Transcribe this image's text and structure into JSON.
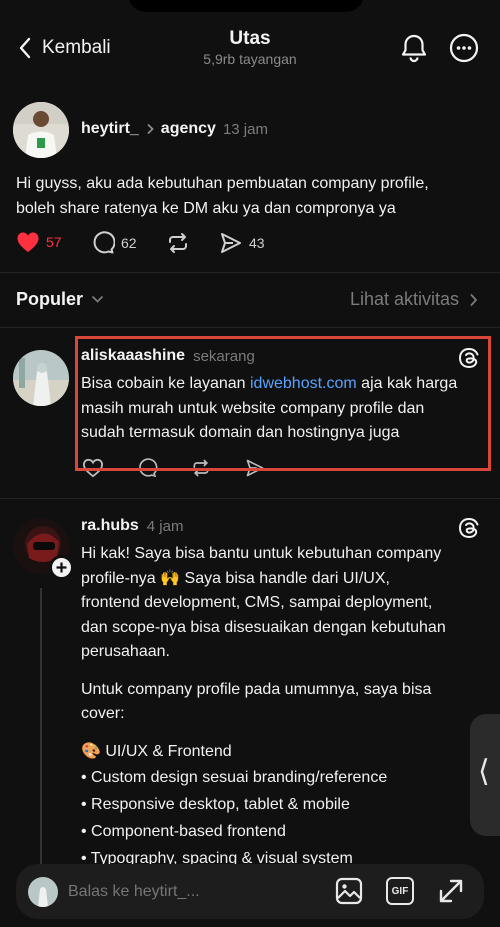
{
  "header": {
    "back_label": "Kembali",
    "title": "Utas",
    "views": "5,9rb tayangan"
  },
  "post": {
    "author": "heytirt_",
    "community": "agency",
    "time": "13 jam",
    "text_lines": [
      "Hi guyss, aku ada kebutuhan pembuatan company profile,",
      "boleh share ratenya ke DM aku ya dan compronya ya"
    ],
    "likes": "57",
    "replies": "62",
    "shares": "43",
    "colors": {
      "like": "#ff3040"
    }
  },
  "sort": {
    "label": "Populer",
    "activity_label": "Lihat aktivitas"
  },
  "replies": [
    {
      "author": "aliskaaashine",
      "time": "sekarang",
      "line1_prefix": "Bisa cobain ke layanan ",
      "line1_link": "idwebhost.com",
      "line1_suffix": " aja kak harga",
      "line2": "masih murah untuk website company profile dan",
      "line3": "sudah termasuk domain dan hostingnya juga"
    },
    {
      "author": "ra.hubs",
      "time": "4 jam",
      "para1": [
        "Hi kak! Saya bisa bantu untuk kebutuhan company",
        "profile-nya 🙌 Saya bisa handle dari UI/UX,",
        "frontend development, CMS, sampai deployment,",
        "dan scope-nya bisa disesuaikan dengan kebutuhan",
        "perusahaan."
      ],
      "para2": [
        "Untuk company profile pada umumnya, saya bisa",
        "cover:"
      ],
      "section_title": "🎨 UI/UX & Frontend",
      "bullets": [
        "• Custom design sesuai branding/reference",
        "• Responsive desktop, tablet & mobile",
        "• Component-based frontend",
        "• Typography, spacing & visual system"
      ]
    }
  ],
  "reply_bar": {
    "placeholder": "Balas ke heytirt_...",
    "gif_label": "GIF"
  },
  "side_handle": {
    "glyph": "⟨"
  }
}
